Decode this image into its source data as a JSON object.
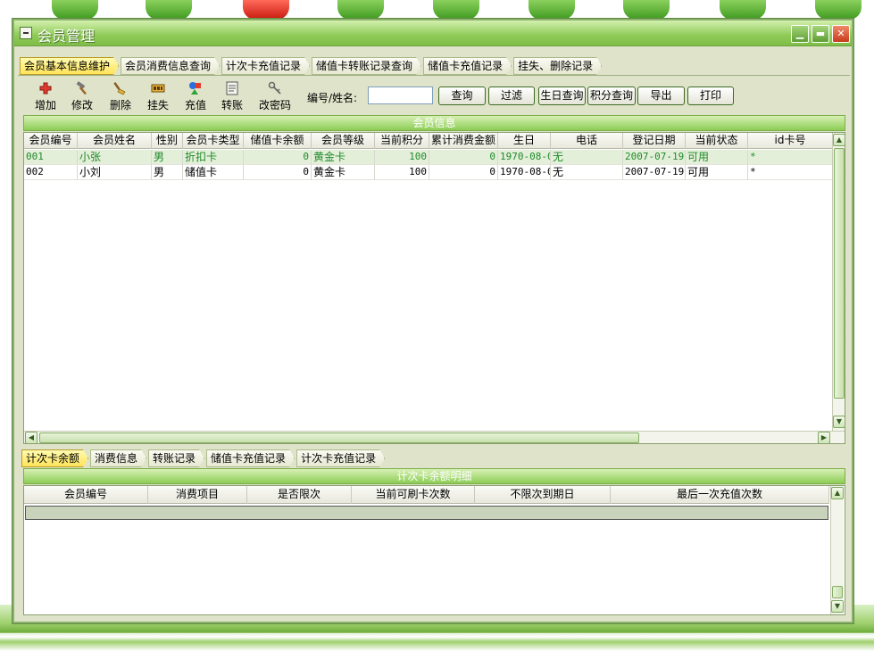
{
  "window": {
    "title": "会员管理"
  },
  "main_tabs": [
    {
      "label": "会员基本信息维护",
      "active": true
    },
    {
      "label": "会员消费信息查询",
      "active": false
    },
    {
      "label": "计次卡充值记录",
      "active": false
    },
    {
      "label": "储值卡转账记录查询",
      "active": false
    },
    {
      "label": "储值卡充值记录",
      "active": false
    },
    {
      "label": "挂失、删除记录",
      "active": false
    }
  ],
  "toolbar": {
    "tools": [
      {
        "label": "增加",
        "icon": "add-icon"
      },
      {
        "label": "修改",
        "icon": "hammer-icon"
      },
      {
        "label": "删除",
        "icon": "broom-icon"
      },
      {
        "label": "挂失",
        "icon": "card-icon"
      },
      {
        "label": "充值",
        "icon": "shapes-icon"
      },
      {
        "label": "转账",
        "icon": "ledger-icon"
      },
      {
        "label": "改密码",
        "icon": "key-icon"
      }
    ],
    "search_label": "编号/姓名:",
    "search_value": "",
    "buttons": [
      "查询",
      "过滤",
      "生日查询",
      "积分查询",
      "导出",
      "打印"
    ]
  },
  "member_panel": {
    "title": "会员信息",
    "columns": [
      "会员编号",
      "会员姓名",
      "性别",
      "会员卡类型",
      "储值卡余额",
      "会员等级",
      "当前积分",
      "累计消费金额",
      "生日",
      "电话",
      "登记日期",
      "当前状态",
      "id卡号"
    ],
    "rows": [
      [
        "001",
        "小张",
        "男",
        "折扣卡",
        "0",
        "黄金卡",
        "100",
        "0",
        "1970-08-0",
        "无",
        "2007-07-19",
        "可用",
        "*"
      ],
      [
        "002",
        "小刘",
        "男",
        "储值卡",
        "0",
        "黄金卡",
        "100",
        "0",
        "1970-08-0",
        "无",
        "2007-07-19",
        "可用",
        "*"
      ]
    ]
  },
  "detail_tabs": [
    {
      "label": "计次卡余额",
      "active": true
    },
    {
      "label": "消费信息",
      "active": false
    },
    {
      "label": "转账记录",
      "active": false
    },
    {
      "label": "储值卡充值记录",
      "active": false
    },
    {
      "label": "计次卡充值记录",
      "active": false
    }
  ],
  "detail_panel": {
    "title": "计次卡余额明细",
    "columns": [
      "会员编号",
      "消费项目",
      "是否限次",
      "当前可刷卡次数",
      "不限次到期日",
      "最后一次充值次数"
    ]
  },
  "colors": {
    "accent_green": "#8ccd55",
    "active_tab": "#ffe35a",
    "selected_row_text": "#1e8a2a"
  }
}
